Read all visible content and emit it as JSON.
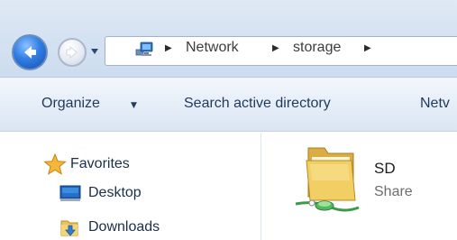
{
  "address_bar": {
    "breadcrumbs": [
      "Network",
      "storage"
    ],
    "location_icon": "network-computer-icon"
  },
  "command_bar": {
    "organize_label": "Organize",
    "search_label": "Search active directory",
    "overflow_label": "Netv"
  },
  "navigation_pane": {
    "items": [
      {
        "label": "Favorites",
        "icon": "star-icon"
      },
      {
        "label": "Desktop",
        "icon": "desktop-icon"
      },
      {
        "label": "Downloads",
        "icon": "downloads-icon"
      }
    ]
  },
  "content": {
    "items": [
      {
        "name": "SD",
        "type": "Share",
        "icon": "shared-folder-icon"
      }
    ]
  }
}
